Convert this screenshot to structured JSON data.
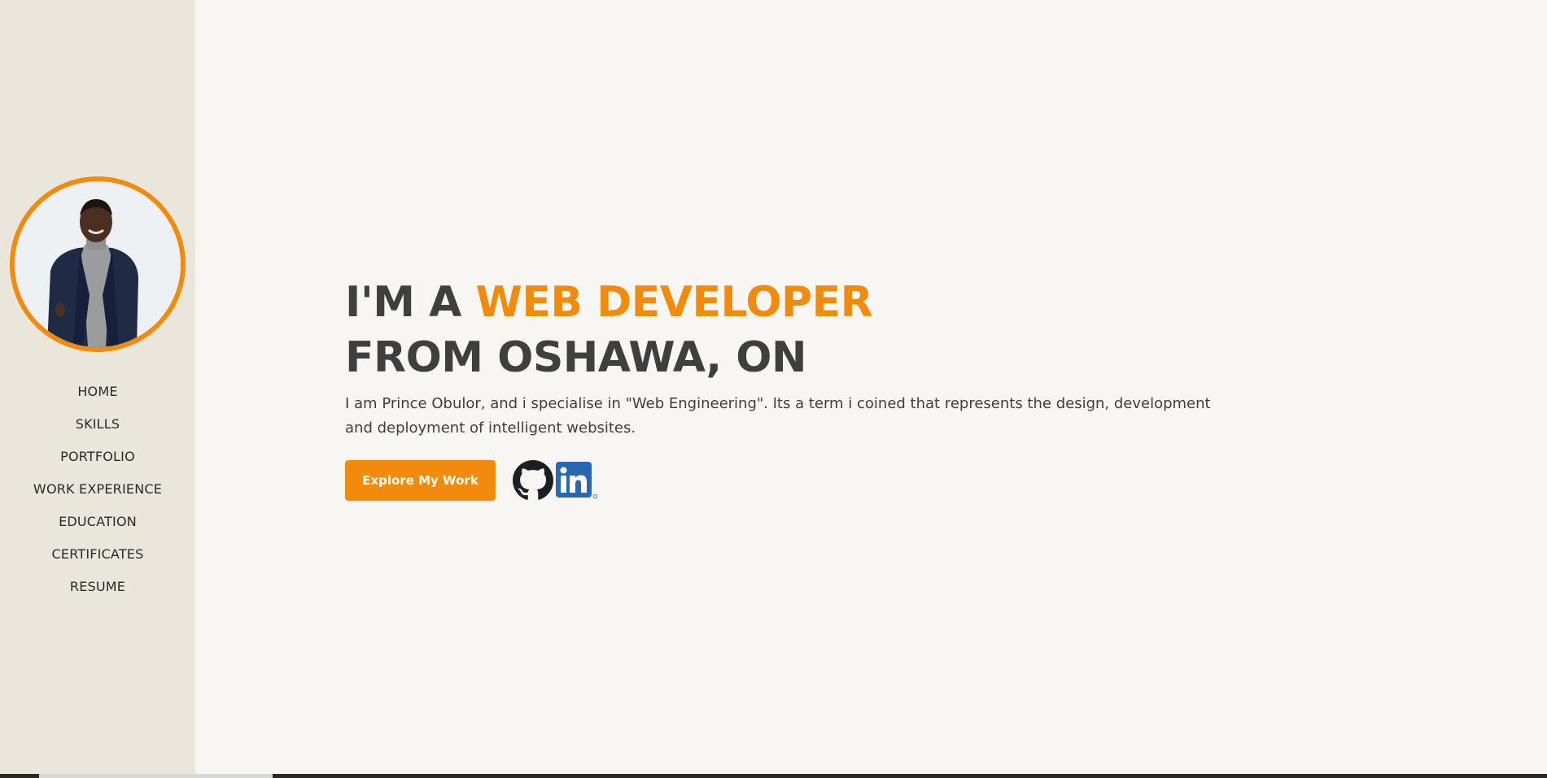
{
  "sidebar": {
    "profile_photo_alt": "Prince Obulor",
    "nav_items": [
      {
        "label": "HOME"
      },
      {
        "label": "SKILLS"
      },
      {
        "label": "PORTFOLIO"
      },
      {
        "label": "WORK EXPERIENCE"
      },
      {
        "label": "EDUCATION"
      },
      {
        "label": "CERTIFICATES"
      },
      {
        "label": "RESUME"
      }
    ]
  },
  "hero": {
    "headline_prefix": "I'M A ",
    "headline_accent": "WEB DEVELOPER",
    "headline_line2": "FROM OSHAWA, ON",
    "intro": "I am Prince Obulor, and i specialise in \"Web Engineering\". Its a term i coined that represents the design, development and deployment of intelligent websites.",
    "cta_label": "Explore My Work"
  },
  "social": {
    "icons": [
      "github-icon",
      "linkedin-icon"
    ]
  },
  "colors": {
    "accent": "#f28a0c",
    "sidebar_bg": "#ebe6dc",
    "page_bg": "#f7f6f3",
    "text": "#3f3f3f",
    "linkedin": "#2867b2"
  }
}
